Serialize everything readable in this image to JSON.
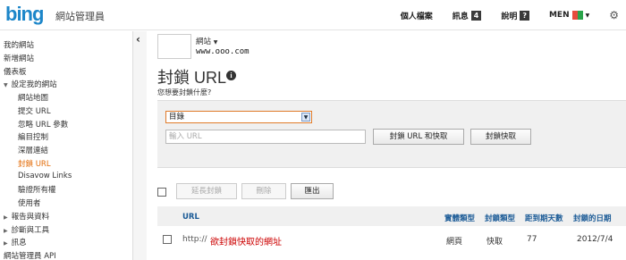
{
  "header": {
    "logo": "bing",
    "app_title": "網站管理員",
    "nav": {
      "profile": "個人檔案",
      "messages": "訊息",
      "messages_count": "4",
      "help": "說明",
      "help_badge": "?",
      "locale": "MEN"
    }
  },
  "sidebar": {
    "items": [
      {
        "label": "我的網站"
      },
      {
        "label": "新增網站"
      },
      {
        "label": "儀表板"
      },
      {
        "label": "設定我的網站"
      },
      {
        "label": "網站地圖"
      },
      {
        "label": "提交 URL"
      },
      {
        "label": "忽略 URL 參數"
      },
      {
        "label": "編目控制"
      },
      {
        "label": "深層連結"
      },
      {
        "label": "封鎖 URL"
      },
      {
        "label": "Disavow Links"
      },
      {
        "label": "驗證所有權"
      },
      {
        "label": "使用者"
      },
      {
        "label": "報告與資料"
      },
      {
        "label": "診斷與工具"
      },
      {
        "label": "訊息"
      },
      {
        "label": "網站管理員 API"
      }
    ]
  },
  "site": {
    "label": "網站",
    "url": "www.ooo.com"
  },
  "page": {
    "title": "封鎖 URL",
    "question": "您想要封鎖什麼?"
  },
  "form": {
    "type_select_value": "目錄",
    "url_placeholder": "輸入 URL",
    "block_url_cache_button": "封鎖 URL 和快取",
    "block_cache_button": "封鎖快取"
  },
  "actions": {
    "extend_button": "延長封鎖",
    "delete_button": "刪除",
    "export_button": "匯出"
  },
  "table": {
    "headers": {
      "url": "URL",
      "entity_type": "實體類型",
      "block_type": "封鎖類型",
      "days_to_expire": "距到期天數",
      "block_date": "封鎖的日期"
    },
    "rows": [
      {
        "url_prefix": "http://",
        "url": "欲封鎖快取的網址",
        "entity_type": "網頁",
        "block_type": "快取",
        "days_to_expire": "77",
        "block_date": "2012/7/4"
      }
    ]
  }
}
